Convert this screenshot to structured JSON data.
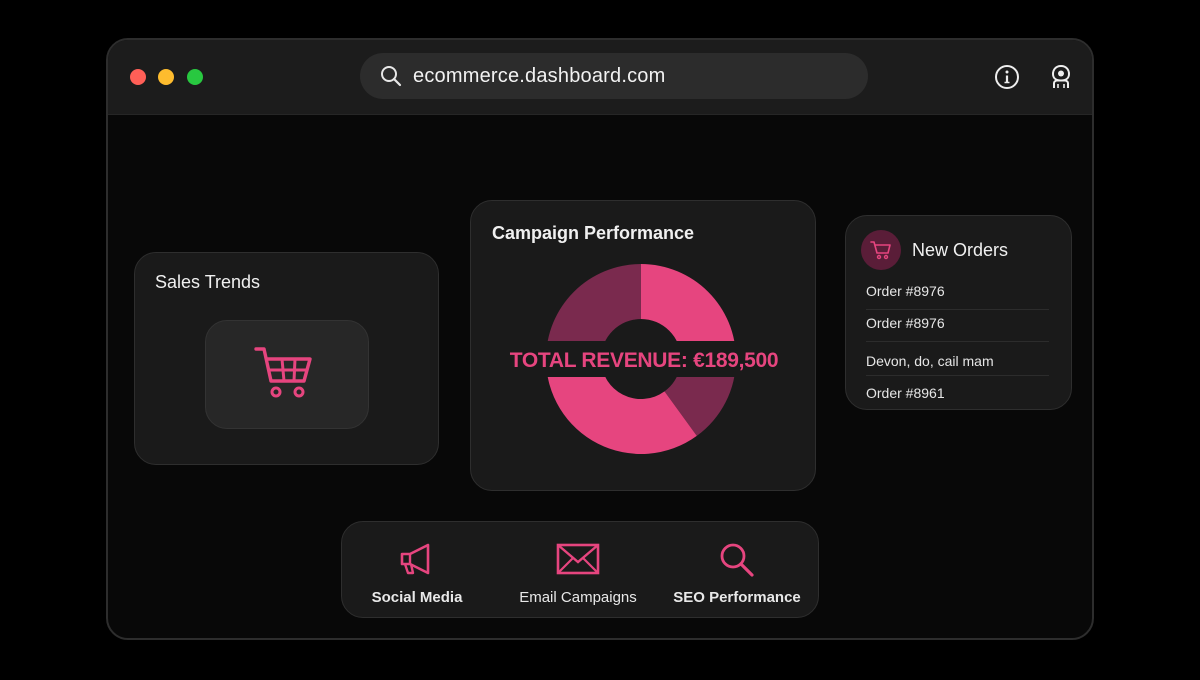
{
  "browser": {
    "url": "ecommerce.dashboard.com"
  },
  "icons": {
    "search": "search-icon",
    "info": "info-icon",
    "profile": "profile-icon",
    "cart": "shopping-cart-icon",
    "megaphone": "megaphone-icon",
    "envelope": "envelope-icon",
    "magnifier": "magnifier-icon"
  },
  "colors": {
    "accent": "#e6457f",
    "accent_dark": "#7a2a4e",
    "window_bg": "#080808",
    "card_bg": "#1a1a1a"
  },
  "sales_trends": {
    "title": "Sales Trends"
  },
  "campaign_performance": {
    "title": "Campaign Performance",
    "total_revenue": "TOTAL REVENUE: €189,500"
  },
  "new_orders": {
    "title": "New Orders",
    "items": [
      "Order #8976",
      "Order #8976",
      "Devon, do, cail mam",
      "Order #8961"
    ]
  },
  "channels": [
    {
      "label": "Social Media"
    },
    {
      "label": "Email Campaigns"
    },
    {
      "label": "SEO Performance"
    }
  ]
}
